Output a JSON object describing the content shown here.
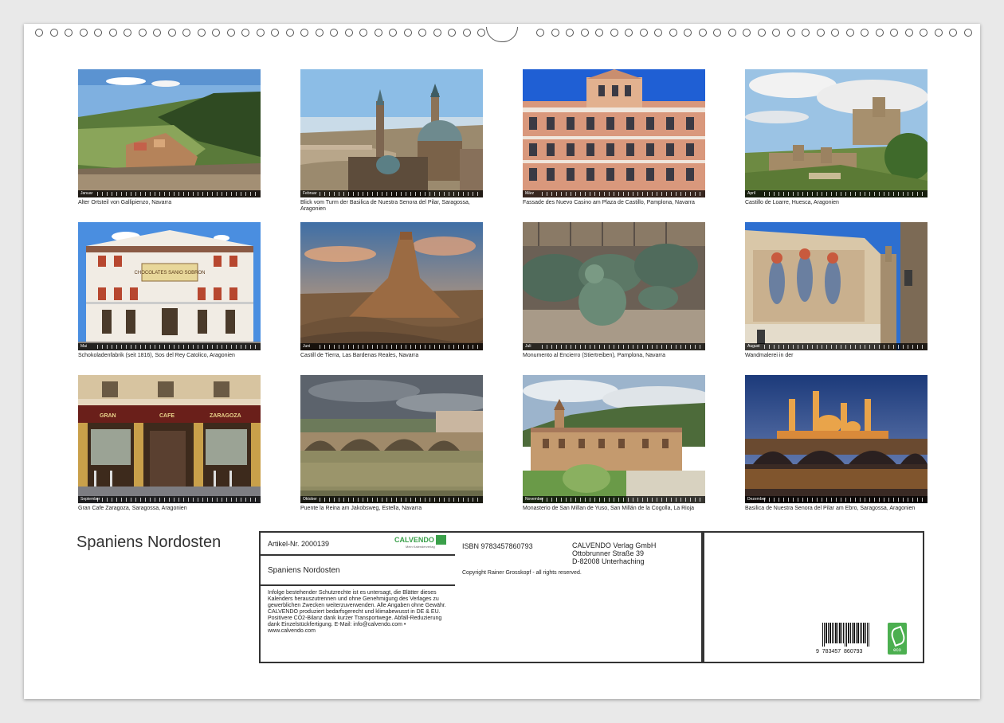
{
  "calendar_title": "Spaniens Nordosten",
  "months": [
    {
      "strip": "Januar",
      "caption": "Alter Ortsteil von Gallipienzo, Navarra"
    },
    {
      "strip": "Februar",
      "caption": "Blick vom Turm der Basilica de Nuestra Senora del Pilar, Saragossa, Aragonien"
    },
    {
      "strip": "März",
      "caption": "Fassade des Nuevo Casino am Plaza de Castillo, Pamplona, Navarra"
    },
    {
      "strip": "April",
      "caption": "Castillo de Loarre, Huesca, Aragonien"
    },
    {
      "strip": "Mai",
      "caption": "Schokoladenfabrik (seit 1816), Sos del Rey Catolico, Aragonien"
    },
    {
      "strip": "Juni",
      "caption": "Castill de Tierra, Las Bardenas Reales, Navarra"
    },
    {
      "strip": "Juli",
      "caption": "Monumento al Encierro (Stiertreiben), Pamplona, Navarra"
    },
    {
      "strip": "August",
      "caption": "Wandmalerei in der"
    },
    {
      "strip": "September",
      "caption": "Gran Cafe Zaragoza, Saragossa, Aragonien"
    },
    {
      "strip": "Oktober",
      "caption": "Puente la Reina am Jakobsweg, Estella, Navarra"
    },
    {
      "strip": "November",
      "caption": "Monasterio de San Millan de Yuso, San Millán de la Cogolla, La Rioja"
    },
    {
      "strip": "Dezember",
      "caption": "Basilica de Nuestra Senora del Pilar am Ebro, Saragossa, Aragonien"
    }
  ],
  "photo_text": {
    "chocolate_sign": "CHOCOLATES SANIO SOBRON",
    "cafe_words": [
      "GRAN",
      "CAFE",
      "ZARAGOZA"
    ]
  },
  "info": {
    "artikel": "Artikel-Nr. 2000139",
    "brand": "CALVENDO",
    "brand_sub": "Mein Kalenderverlag",
    "title": "Spaniens Nordosten",
    "legal": "Infolge bestehender Schutzrechte ist es untersagt, die Blätter dieses Kalenders herauszutrennen und ohne Genehmigung des Verlages zu gewerblichen Zwecken weiterzuverwenden. Alle Angaben ohne Gewähr. CALVENDO produziert bedarfsgerecht und klimabewusst in DE & EU. Positivere CO2-Bilanz dank kurzer Transportwege. Abfall-Reduzierung dank Einzelstückfertigung. E-Mail: info@calvendo.com • www.calvendo.com",
    "isbn": "ISBN 9783457860793",
    "publisher_name": "CALVENDO Verlag GmbH",
    "publisher_street": "Ottobrunner Straße 39",
    "publisher_city": "D-82008 Unterhaching",
    "copyright": "Copyright Rainer Grosskopf - all rights reserved.",
    "barcode_number": "9  783457  860793",
    "eco_label": "eco"
  },
  "colors": {
    "border": "#333333",
    "calvendo_green": "#3aa04a",
    "eco_green": "#4caf50"
  }
}
